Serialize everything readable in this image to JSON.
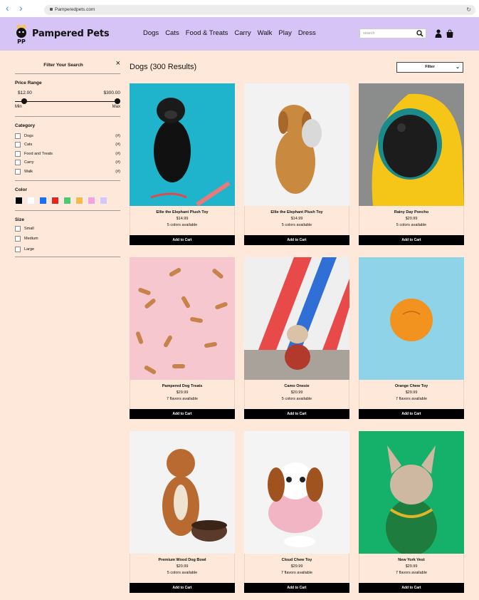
{
  "browser": {
    "url": "Pamperedpets.com",
    "back": "‹",
    "forward": "›",
    "reload": "↻"
  },
  "header": {
    "brand": "Pampered Pets",
    "logo_text": "PP",
    "nav": [
      "Dogs",
      "Cats",
      "Food & Treats",
      "Carry",
      "Walk",
      "Play",
      "Dress"
    ],
    "search_placeholder": "search"
  },
  "sidebar": {
    "title": "Filter Your Search",
    "close": "×",
    "price": {
      "title": "Price Range",
      "min_value": "$12.00",
      "max_value": "$300.00",
      "min_label": "Min",
      "max_label": "Max"
    },
    "category": {
      "title": "Category",
      "items": [
        {
          "label": "Dogs",
          "count": "(#)"
        },
        {
          "label": "Cats",
          "count": "(#)"
        },
        {
          "label": "Food and Treats",
          "count": "(#)"
        },
        {
          "label": "Carry",
          "count": "(#)"
        },
        {
          "label": "Walk",
          "count": "(#)"
        }
      ]
    },
    "color": {
      "title": "Color",
      "swatches": [
        "#000000",
        "#ffffff",
        "#1a6ff5",
        "#e5241c",
        "#4fc96b",
        "#f7b948",
        "#f4a2e0",
        "#d9c5fb"
      ]
    },
    "size": {
      "title": "Size",
      "items": [
        "Small",
        "Medium",
        "Large"
      ]
    }
  },
  "main": {
    "title": "Dogs (300 Results)",
    "filter_label": "Filter",
    "products": [
      {
        "name": "Ellie the Elephant Plush Toy",
        "price": "$14.99",
        "availability": "5 colors available",
        "cta": "Add to Cart"
      },
      {
        "name": "Ellie the Elephant Plush Toy",
        "price": "$14.99",
        "availability": "5 colors available",
        "cta": "Add to Cart"
      },
      {
        "name": "Rainy Day Poncho",
        "price": "$20.99",
        "availability": "5 colors available",
        "cta": "Add to Cart"
      },
      {
        "name": "Pampered Dog Treats",
        "price": "$29.99",
        "availability": "7 flavors available",
        "cta": "Add to Cart"
      },
      {
        "name": "Camo Onesie",
        "price": "$20.99",
        "availability": "5 colors available",
        "cta": "Add to Cart"
      },
      {
        "name": "Orange Chew Toy",
        "price": "$29.99",
        "availability": "7 flavors available",
        "cta": "Add to Cart"
      },
      {
        "name": "Premium Wood Dog Bowl",
        "price": "$20.99",
        "availability": "5 colors available",
        "cta": "Add to Cart"
      },
      {
        "name": "Cloud Chew Toy",
        "price": "$29.99",
        "availability": "7 flavors available",
        "cta": "Add to Cart"
      },
      {
        "name": "New York Vest",
        "price": "$29.99",
        "availability": "7 flavors available",
        "cta": "Add to Cart"
      }
    ]
  }
}
